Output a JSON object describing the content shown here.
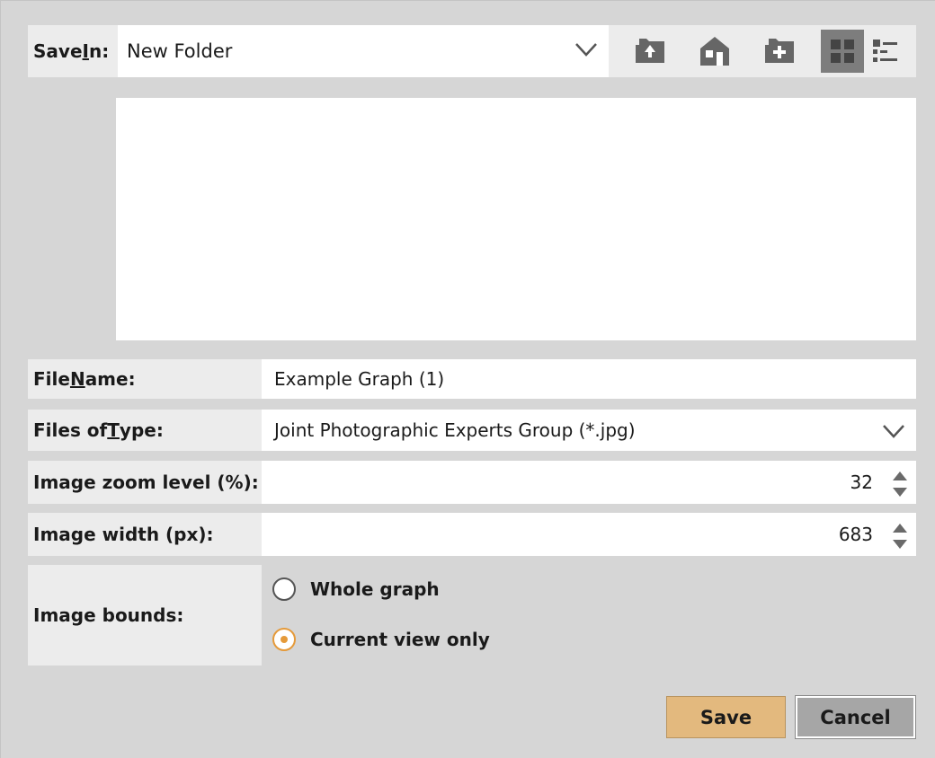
{
  "save_in": {
    "label_prefix": "Save ",
    "label_mnemonic": "I",
    "label_suffix": "n:",
    "value": "New Folder"
  },
  "toolbar": {
    "icons": [
      "up-folder-icon",
      "home-icon",
      "new-folder-icon",
      "grid-view-icon",
      "list-view-icon"
    ]
  },
  "file_name": {
    "label_prefix": "File ",
    "label_mnemonic": "N",
    "label_suffix": "ame:",
    "value": "Example Graph (1)"
  },
  "files_of_type": {
    "label_prefix": "Files of ",
    "label_mnemonic": "T",
    "label_suffix": "ype:",
    "value": "Joint Photographic Experts Group (*.jpg)"
  },
  "zoom": {
    "label": "Image zoom level (%):",
    "value": "32"
  },
  "width": {
    "label": "Image width (px):",
    "value": "683"
  },
  "bounds": {
    "label": "Image bounds:",
    "options": [
      "Whole graph",
      "Current view only"
    ],
    "selected": "Current view only"
  },
  "buttons": {
    "save": "Save",
    "cancel": "Cancel"
  },
  "colors": {
    "accent": "#e59a3a",
    "save_button": "#e3b97e",
    "cancel_button": "#a6a6a6",
    "active_toolbar": "#7d7d7d"
  }
}
